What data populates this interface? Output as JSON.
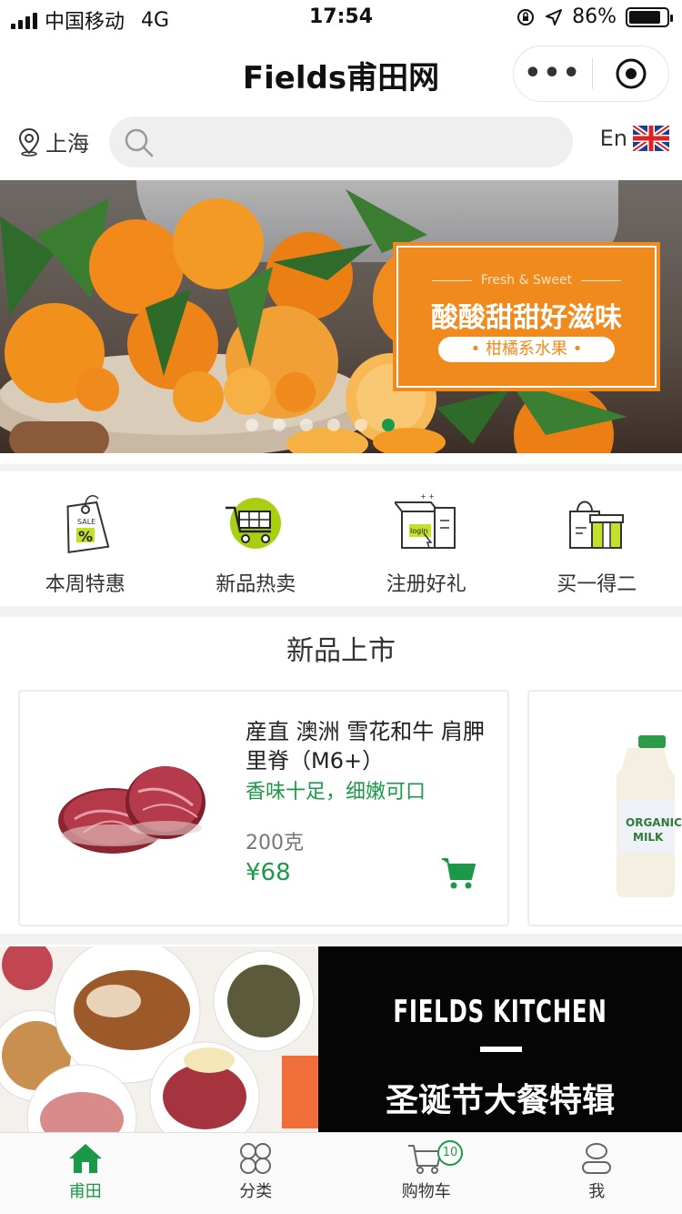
{
  "status_bar": {
    "carrier": "中国移动",
    "network": "4G",
    "time": "17:54",
    "battery": "86%",
    "battery_level": 0.86
  },
  "navbar": {
    "title": "Fields甫田网",
    "more_label": "•••"
  },
  "location": {
    "city": "上海"
  },
  "search": {
    "placeholder": "",
    "value": ""
  },
  "language": {
    "label": "En",
    "flag_icon": "uk-flag-icon"
  },
  "banner": {
    "tagline_en": "Fresh & Sweet",
    "headline": "酸酸甜甜好滋味",
    "pill": "• 柑橘系水果 •",
    "active_slide": 6,
    "slide_count": 6
  },
  "quick_entries": [
    {
      "label": "本周特惠",
      "icon": "sale-tag-icon"
    },
    {
      "label": "新品热卖",
      "icon": "cart-circle-icon"
    },
    {
      "label": "注册好礼",
      "icon": "login-gift-box-icon"
    },
    {
      "label": "买一得二",
      "icon": "gift-bag-icon"
    }
  ],
  "new_products": {
    "section_title": "新品上市",
    "items": [
      {
        "name": "産直 澳洲 雪花和牛 肩胛里脊（M6+）",
        "slogan": "香味十足，细嫩可口",
        "weight": "200克",
        "price": "¥68"
      }
    ]
  },
  "kitchen_banner": {
    "brand": "FIELDS KITCHEN",
    "subtitle": "圣诞节大餐特辑"
  },
  "tabbar": {
    "tabs": [
      {
        "label": "甫田",
        "icon": "home-icon",
        "active": true
      },
      {
        "label": "分类",
        "icon": "category-icon",
        "active": false
      },
      {
        "label": "购物车",
        "icon": "cart-icon",
        "active": false,
        "badge": "10"
      },
      {
        "label": "我",
        "icon": "user-icon",
        "active": false
      }
    ]
  },
  "colors": {
    "accent_green": "#1a9a49",
    "banner_orange": "#f08a1c",
    "kitchen_black": "#050505"
  }
}
